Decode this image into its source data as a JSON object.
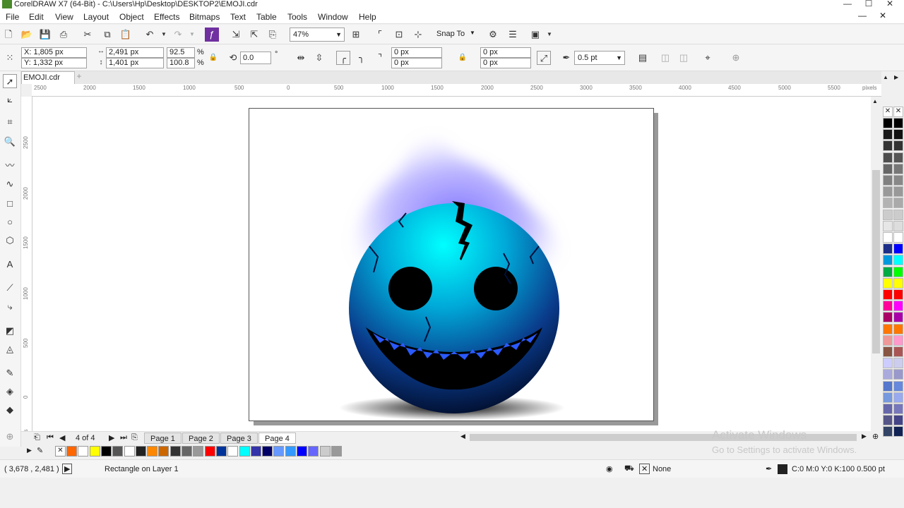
{
  "window": {
    "title": "CorelDRAW X7 (64-Bit) - C:\\Users\\Hp\\Desktop\\DESKTOP2\\EMOJI.cdr"
  },
  "menu": [
    "File",
    "Edit",
    "View",
    "Layout",
    "Object",
    "Effects",
    "Bitmaps",
    "Text",
    "Table",
    "Tools",
    "Window",
    "Help"
  ],
  "toolbar": {
    "zoom": "47%",
    "snap_to": "Snap To"
  },
  "property_bar": {
    "x": "X: 1,805 px",
    "y": "Y: 1,332 px",
    "width": "2,491 px",
    "height": "1,401 px",
    "scale_x": "92.5",
    "scale_y": "100.8",
    "pct1": "%",
    "pct2": "%",
    "rotation": "0.0",
    "degree": "°",
    "corner1": "0 px",
    "corner2": "0 px",
    "corner3": "0 px",
    "corner4": "0 px",
    "outline": "0.5 pt"
  },
  "document_tab": "EMOJI.cdr",
  "ruler": {
    "h_labels": [
      "2500",
      "2000",
      "1500",
      "1000",
      "500",
      "0",
      "500",
      "1000",
      "1500",
      "2000",
      "2500",
      "3000",
      "3500",
      "4000",
      "4500",
      "5000",
      "5500"
    ],
    "units": "pixels",
    "v_labels": [
      "2500",
      "2000",
      "1500",
      "1000",
      "500",
      "0"
    ],
    "v_units": "pixels"
  },
  "pages": {
    "indicator": "4 of 4",
    "tabs": [
      "Page 1",
      "Page 2",
      "Page 3",
      "Page 4"
    ],
    "active": 3
  },
  "status": {
    "coords": "( 3,678 , 2,481 )",
    "selection": "Rectangle on Layer 1",
    "fill": "None",
    "outline": "C:0 M:0 Y:0 K:100  0.500 pt"
  },
  "watermark": {
    "line1": "Activate Windows",
    "line2": "Go to Settings to activate Windows."
  },
  "document_palette": [
    "#ff6600",
    "#ffffff",
    "#ffff00",
    "#000000",
    "#555555",
    "#ffffff",
    "#222222",
    "#ff8800",
    "#cc6600",
    "#333333",
    "#666666",
    "#999999",
    "#ff0000",
    "#003399",
    "#ffffff",
    "#00ffff",
    "#3333aa",
    "#000066",
    "#6699ff",
    "#3399ff",
    "#0000ff",
    "#6666ff",
    "#cccccc",
    "#999999"
  ],
  "color_palette": [
    [
      "#000000",
      "#000000"
    ],
    [
      "#1a1a1a",
      "#111111"
    ],
    [
      "#333333",
      "#333333"
    ],
    [
      "#4d4d4d",
      "#555555"
    ],
    [
      "#666666",
      "#777777"
    ],
    [
      "#808080",
      "#888888"
    ],
    [
      "#999999",
      "#999999"
    ],
    [
      "#b3b3b3",
      "#aaaaaa"
    ],
    [
      "#cccccc",
      "#cccccc"
    ],
    [
      "#e6e6e6",
      "#dddddd"
    ],
    [
      "#ffffff",
      "#ffffff"
    ],
    [
      "#1e2f8a",
      "#0000ff"
    ],
    [
      "#0099dd",
      "#00ffff"
    ],
    [
      "#00aa44",
      "#00ff00"
    ],
    [
      "#ffff00",
      "#ffff00"
    ],
    [
      "#ff0000",
      "#ff0000"
    ],
    [
      "#ff0099",
      "#ff00ff"
    ],
    [
      "#aa0066",
      "#aa00aa"
    ],
    [
      "#ff7700",
      "#ff7700"
    ],
    [
      "#ee9999",
      "#ff99cc"
    ],
    [
      "#885544",
      "#aa5555"
    ],
    [
      "#ccccff",
      "#ccccee"
    ],
    [
      "#aaaadd",
      "#9999cc"
    ],
    [
      "#5577cc",
      "#6688dd"
    ],
    [
      "#7799dd",
      "#99aaee"
    ],
    [
      "#6666aa",
      "#7777bb"
    ],
    [
      "#555588",
      "#444488"
    ],
    [
      "#334466",
      "#112255"
    ]
  ]
}
